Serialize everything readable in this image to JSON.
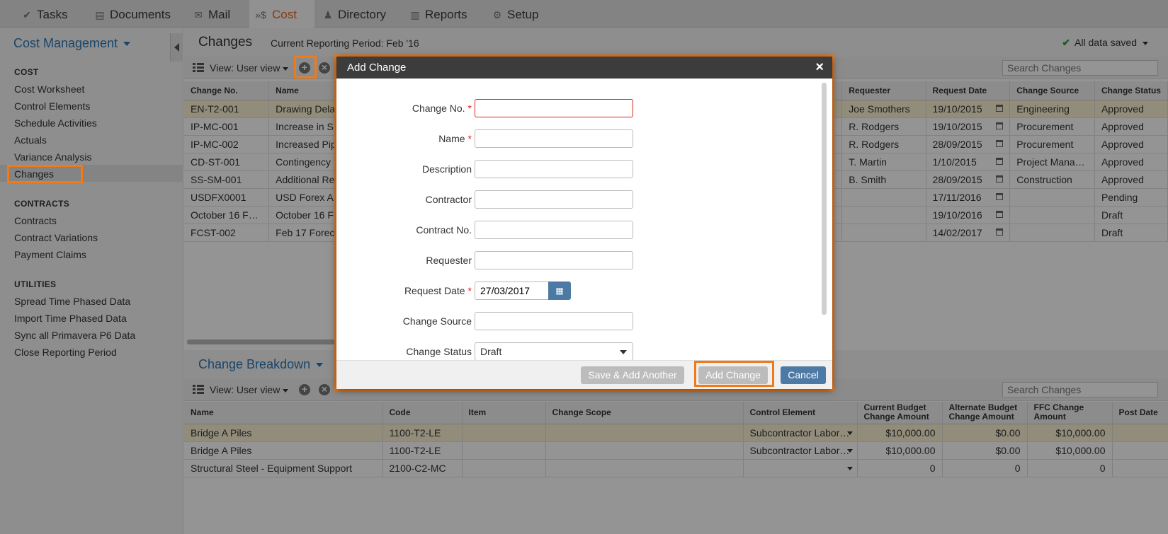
{
  "topnav": {
    "items": [
      {
        "label": "Tasks",
        "icon": "check-icon"
      },
      {
        "label": "Documents",
        "icon": "document-icon"
      },
      {
        "label": "Mail",
        "icon": "envelope-icon"
      },
      {
        "label": "Cost",
        "icon": "cost-icon",
        "active": true
      },
      {
        "label": "Directory",
        "icon": "people-icon"
      },
      {
        "label": "Reports",
        "icon": "bar-chart-icon"
      },
      {
        "label": "Setup",
        "icon": "gear-icon"
      }
    ]
  },
  "sidebar": {
    "title": "Cost Management",
    "sections": [
      {
        "heading": "COST",
        "items": [
          "Cost Worksheet",
          "Control Elements",
          "Schedule Activities",
          "Actuals",
          "Variance Analysis",
          "Changes"
        ]
      },
      {
        "heading": "CONTRACTS",
        "items": [
          "Contracts",
          "Contract Variations",
          "Payment Claims"
        ]
      },
      {
        "heading": "UTILITIES",
        "items": [
          "Spread Time Phased Data",
          "Import Time Phased Data",
          "Sync all Primavera P6 Data",
          "Close Reporting Period"
        ]
      }
    ],
    "selected": "Changes"
  },
  "header": {
    "title": "Changes",
    "period": "Current Reporting Period: Feb '16",
    "saved": "All data saved"
  },
  "changes_toolbar": {
    "view_label": "View: User view",
    "search_placeholder": "Search Changes"
  },
  "changes_table": {
    "columns": [
      "Change No.",
      "Name",
      "Requester",
      "Request Date",
      "Change Source",
      "Change Status"
    ],
    "rows": [
      {
        "no": "EN-T2-001",
        "name": "Drawing Dela",
        "requester": "Joe Smothers",
        "date": "19/10/2015",
        "source": "Engineering",
        "status": "Approved"
      },
      {
        "no": "IP-MC-001",
        "name": "Increase in S",
        "requester": "R. Rodgers",
        "date": "19/10/2015",
        "source": "Procurement",
        "status": "Approved"
      },
      {
        "no": "IP-MC-002",
        "name": "Increased Pip",
        "requester": "R. Rodgers",
        "date": "28/09/2015",
        "source": "Procurement",
        "status": "Approved"
      },
      {
        "no": "CD-ST-001",
        "name": "Contingency",
        "requester": "T. Martin",
        "date": "1/10/2015",
        "source": "Project Mana…",
        "status": "Approved"
      },
      {
        "no": "SS-SM-001",
        "name": "Additional Re",
        "requester": "B. Smith",
        "date": "28/09/2015",
        "source": "Construction",
        "status": "Approved"
      },
      {
        "no": "USDFX0001",
        "name": "USD Forex A",
        "requester": "",
        "date": "17/11/2016",
        "source": "",
        "status": "Pending"
      },
      {
        "no": "October 16 F…",
        "name": "October 16 F",
        "requester": "",
        "date": "19/10/2016",
        "source": "",
        "status": "Draft"
      },
      {
        "no": "FCST-002",
        "name": "Feb 17 Forec",
        "requester": "",
        "date": "14/02/2017",
        "source": "",
        "status": "Draft"
      }
    ]
  },
  "breakdown": {
    "title": "Change Breakdown",
    "view_label": "View: User view",
    "search_placeholder": "Search Changes",
    "columns": [
      "Name",
      "Code",
      "Item",
      "Change Scope",
      "Control Element",
      "Current Budget Change Amount",
      "Alternate Budget Change Amount",
      "FFC Change Amount",
      "Post Date"
    ],
    "rows": [
      {
        "name": "Bridge A Piles",
        "code": "1100-T2-LE",
        "item": "",
        "scope": "",
        "element": "Subcontractor Labor…",
        "current": "$10,000.00",
        "alternate": "$0.00",
        "ffc": "$10,000.00",
        "post": ""
      },
      {
        "name": "Bridge A Piles",
        "code": "1100-T2-LE",
        "item": "",
        "scope": "",
        "element": "Subcontractor Labor…",
        "current": "$10,000.00",
        "alternate": "$0.00",
        "ffc": "$10,000.00",
        "post": ""
      },
      {
        "name": "Structural Steel - Equipment Support",
        "code": "2100-C2-MC",
        "item": "",
        "scope": "",
        "element": "",
        "current": "0",
        "alternate": "0",
        "ffc": "0",
        "post": ""
      }
    ]
  },
  "modal": {
    "title": "Add Change",
    "fields": [
      {
        "label": "Change No.",
        "required": true,
        "value": ""
      },
      {
        "label": "Name",
        "required": true,
        "value": ""
      },
      {
        "label": "Description",
        "required": false,
        "value": ""
      },
      {
        "label": "Contractor",
        "required": false,
        "value": ""
      },
      {
        "label": "Contract No.",
        "required": false,
        "value": ""
      },
      {
        "label": "Requester",
        "required": false,
        "value": ""
      },
      {
        "label": "Request Date",
        "required": true,
        "value": "27/03/2017"
      },
      {
        "label": "Change Source",
        "required": false,
        "value": ""
      },
      {
        "label": "Change Status",
        "required": false,
        "value": "Draft"
      }
    ],
    "buttons": {
      "save_add_another": "Save & Add Another",
      "add_change": "Add Change",
      "cancel": "Cancel"
    }
  },
  "colors": {
    "accent": "#e8641e",
    "link": "#2d78b7",
    "highlight": "#ef7a1a",
    "primary_button": "#4d7aa4",
    "required": "#d9261c"
  }
}
